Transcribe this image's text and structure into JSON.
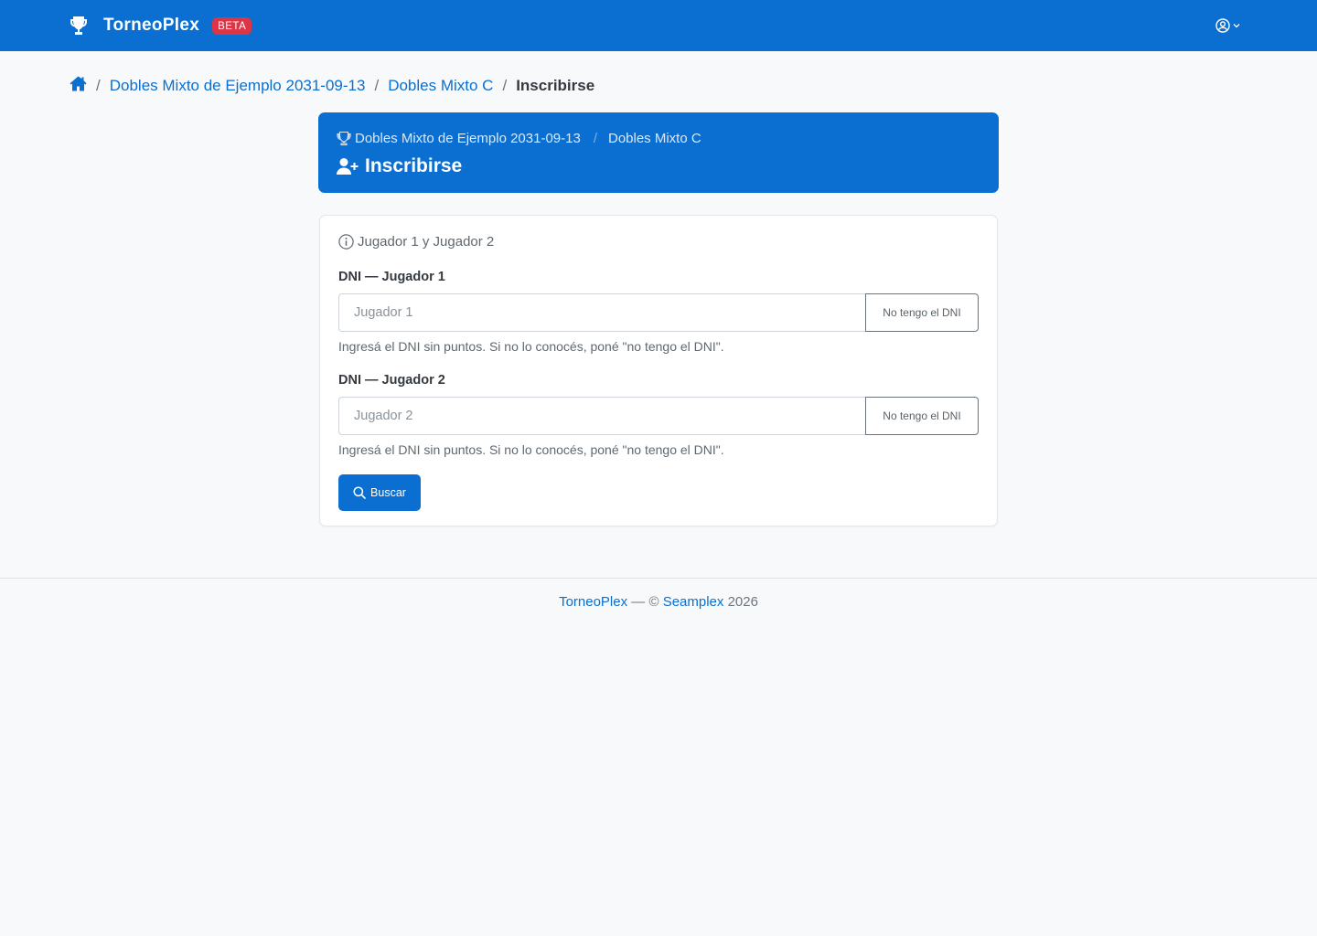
{
  "navbar": {
    "brand": "TorneoPlex",
    "badge": "BETA",
    "user_menu_icon": "user-circle-icon",
    "colors": {
      "primary": "#0a6fd1",
      "badge": "#dc3545"
    }
  },
  "breadcrumb": {
    "home_icon": "home-icon",
    "items": [
      {
        "label": "Dobles Mixto de Ejemplo 2031-09-13"
      },
      {
        "label": "Dobles Mixto C"
      }
    ],
    "current": "Inscribirse",
    "separator": "/"
  },
  "header_card": {
    "tournament": "Dobles Mixto de Ejemplo 2031-09-13",
    "separator": "/",
    "category": "Dobles Mixto C",
    "title": "Inscribirse"
  },
  "form": {
    "info": "Jugador 1 y Jugador 2",
    "player1": {
      "label": "DNI — Jugador 1",
      "placeholder": "Jugador 1",
      "value": "",
      "no_dni_button": "No tengo el DNI",
      "help": "Ingresá el DNI sin puntos. Si no lo conocés, poné \"no tengo el DNI\"."
    },
    "player2": {
      "label": "DNI — Jugador 2",
      "placeholder": "Jugador 2",
      "value": "",
      "no_dni_button": "No tengo el DNI",
      "help": "Ingresá el DNI sin puntos. Si no lo conocés, poné \"no tengo el DNI\"."
    },
    "search_button": "Buscar"
  },
  "footer": {
    "brand_link": "TorneoPlex",
    "separator": "— ©",
    "company_link": "Seamplex",
    "year": "2026"
  }
}
